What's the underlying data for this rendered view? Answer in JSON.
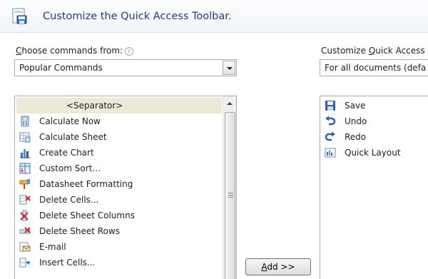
{
  "dialog": {
    "title": "Customize the Quick Access Toolbar."
  },
  "left": {
    "label_pre": "",
    "label_ul": "C",
    "label_post": "hoose commands from:",
    "source": "Popular Commands",
    "commands": [
      {
        "label": "<Separator>",
        "icon": "separator",
        "selected": true
      },
      {
        "label": "Calculate Now",
        "icon": "calculator-icon"
      },
      {
        "label": "Calculate Sheet",
        "icon": "calculate-sheet-icon"
      },
      {
        "label": "Create Chart",
        "icon": "chart-icon"
      },
      {
        "label": "Custom Sort...",
        "icon": "sort-icon"
      },
      {
        "label": "Datasheet Formatting",
        "icon": "datasheet-format-icon"
      },
      {
        "label": "Delete Cells...",
        "icon": "delete-cells-icon"
      },
      {
        "label": "Delete Sheet Columns",
        "icon": "delete-columns-icon"
      },
      {
        "label": "Delete Sheet Rows",
        "icon": "delete-rows-icon"
      },
      {
        "label": "E-mail",
        "icon": "email-icon"
      },
      {
        "label": "Insert Cells...",
        "icon": "insert-cells-icon"
      }
    ]
  },
  "right": {
    "label_pre": "Customize ",
    "label_ul": "Q",
    "label_post": "uick Access",
    "scope": "For all documents (defa",
    "items": [
      {
        "label": "Save",
        "icon": "save-icon"
      },
      {
        "label": "Undo",
        "icon": "undo-icon"
      },
      {
        "label": "Redo",
        "icon": "redo-icon"
      },
      {
        "label": "Quick Layout",
        "icon": "quick-layout-icon"
      }
    ]
  },
  "add_button": {
    "label_ul": "A",
    "label_post": "dd >>"
  },
  "colors": {
    "title": "#233a88",
    "selection": "#ece9d8"
  }
}
